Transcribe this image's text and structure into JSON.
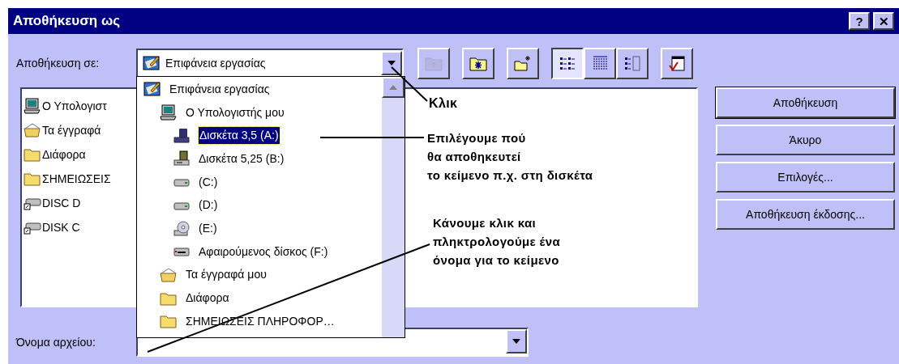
{
  "window": {
    "title": "Αποθήκευση ως",
    "title_buttons": [
      "?",
      "✕"
    ]
  },
  "save_in": {
    "label": "Αποθήκευση σε:",
    "value": "Επιφάνεια εργασίας",
    "kind": "desktop"
  },
  "toolbar": [
    {
      "kind": "up",
      "disabled": true,
      "selected": false
    },
    {
      "kind": "webfolder",
      "disabled": false,
      "selected": false
    },
    {
      "kind": "newfolder",
      "disabled": false,
      "selected": false
    },
    {
      "kind": "list",
      "disabled": false,
      "selected": true
    },
    {
      "kind": "details",
      "disabled": false,
      "selected": false
    },
    {
      "kind": "properties",
      "disabled": false,
      "selected": false
    },
    {
      "kind": "tools",
      "disabled": false,
      "selected": false
    }
  ],
  "files": [
    {
      "name": "Ο Υπολογιστ",
      "kind": "computer"
    },
    {
      "name": "Τα έγγραφά",
      "kind": "documents"
    },
    {
      "name": "Διάφορα",
      "kind": "folder"
    },
    {
      "name": "ΣΗΜΕΙΩΣΕΙΣ",
      "kind": "folder"
    },
    {
      "name": "DISC D",
      "kind": "netdrive"
    },
    {
      "name": "DISK C",
      "kind": "netdrive"
    }
  ],
  "dropdown": [
    {
      "name": "Επιφάνεια εργασίας",
      "kind": "desktop",
      "selected": false,
      "children": [
        {
          "name": "Ο Υπολογιστής μου",
          "kind": "computer",
          "selected": false,
          "children": [
            {
              "name": "Δισκέτα 3,5 (A:)",
              "kind": "floppy35",
              "selected": true
            },
            {
              "name": "Δισκέτα 5,25 (B:)",
              "kind": "floppy525",
              "selected": false
            },
            {
              "name": "(C:)",
              "kind": "harddisk",
              "selected": false
            },
            {
              "name": "(D:)",
              "kind": "harddisk",
              "selected": false
            },
            {
              "name": "(E:)",
              "kind": "cdrom",
              "selected": false
            },
            {
              "name": "Αφαιρούμενος δίσκος (F:)",
              "kind": "removable",
              "selected": false
            }
          ]
        },
        {
          "name": "Τα έγγραφά μου",
          "kind": "documents",
          "selected": false
        },
        {
          "name": "Διάφορα",
          "kind": "folder",
          "selected": false
        },
        {
          "name": "ΣΗΜΕΙΩΣΕΙΣ ΠΛΗΡΟΦΟΡ…",
          "kind": "folder",
          "selected": false
        }
      ]
    }
  ],
  "buttons": [
    {
      "label": "Αποθήκευση",
      "default": true
    },
    {
      "label": "Άκυρο",
      "default": false
    },
    {
      "label": "Επιλογές...",
      "default": false
    },
    {
      "label": "Αποθήκευση έκδοσης...",
      "default": false
    }
  ],
  "filename": {
    "label": "Όνομα αρχείου:"
  },
  "annotations": [
    {
      "lines": [
        "Κλικ"
      ]
    },
    {
      "lines": [
        "Επιλέγουμε πού",
        "θα αποθηκευτεί",
        "το κείμενο π.χ. στη δισκέτα"
      ]
    },
    {
      "lines": [
        "Κάνουμε κλικ και",
        "πληκτρολογούμε ένα",
        "όνομα για το κείμενο"
      ]
    }
  ]
}
